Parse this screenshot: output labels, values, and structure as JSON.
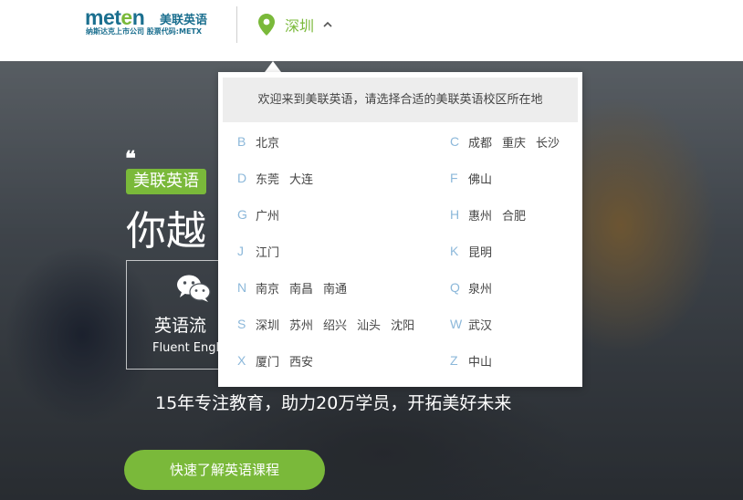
{
  "header": {
    "logo_mark_a": "met",
    "logo_mark_b": "e",
    "logo_mark_c": "n",
    "logo_name": "美联英语",
    "logo_sub": "纳斯达克上市公司 股票代码:METX",
    "current_city": "深圳",
    "pin_icon": "location-pin-icon",
    "chevron_icon": "chevron-up-icon"
  },
  "colors": {
    "brand_green": "#7ab93a",
    "brand_blue": "#1b6f8f",
    "letter_blue": "#8cb8da"
  },
  "hero": {
    "quote": "❝",
    "brand_tag": "美联英语",
    "title": "你越",
    "feature_title": "英语流",
    "feature_sub": "Fluent Engl",
    "feature_icon": "wechat-icon",
    "tagline": "15年专注教育，助力20万学员，开拓美好未来",
    "cta_label": "快速了解英语课程"
  },
  "dropdown": {
    "header": "欢迎来到美联英语，请选择合适的美联英语校区所在地",
    "left_groups": [
      {
        "letter": "B",
        "cities": [
          "北京"
        ]
      },
      {
        "letter": "D",
        "cities": [
          "东莞",
          "大连"
        ]
      },
      {
        "letter": "G",
        "cities": [
          "广州"
        ]
      },
      {
        "letter": "J",
        "cities": [
          "江门"
        ]
      },
      {
        "letter": "N",
        "cities": [
          "南京",
          "南昌",
          "南通"
        ]
      },
      {
        "letter": "S",
        "cities": [
          "深圳",
          "苏州",
          "绍兴",
          "汕头",
          "沈阳"
        ]
      },
      {
        "letter": "X",
        "cities": [
          "厦门",
          "西安"
        ]
      }
    ],
    "right_groups": [
      {
        "letter": "C",
        "cities": [
          "成都",
          "重庆",
          "长沙"
        ]
      },
      {
        "letter": "F",
        "cities": [
          "佛山"
        ]
      },
      {
        "letter": "H",
        "cities": [
          "惠州",
          "合肥"
        ]
      },
      {
        "letter": "K",
        "cities": [
          "昆明"
        ]
      },
      {
        "letter": "Q",
        "cities": [
          "泉州"
        ]
      },
      {
        "letter": "W",
        "cities": [
          "武汉"
        ]
      },
      {
        "letter": "Z",
        "cities": [
          "中山"
        ]
      }
    ]
  }
}
